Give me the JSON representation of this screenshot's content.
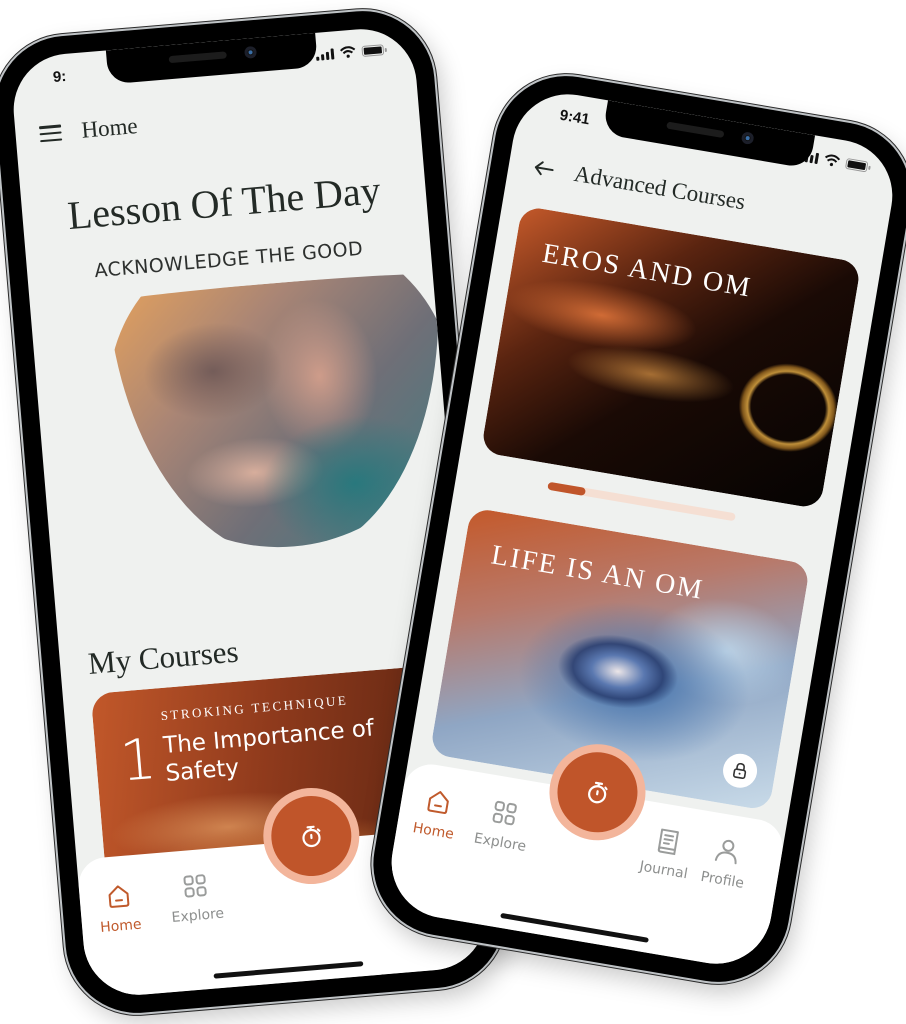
{
  "phones": {
    "left": {
      "status": {
        "time": "9:"
      },
      "header": {
        "title": "Home"
      },
      "lesson": {
        "heading": "Lesson Of The Day",
        "subtitle": "ACKNOWLEDGE THE GOOD",
        "image_alt": "Bare feet resting on cushions"
      },
      "my_courses": {
        "heading": "My Courses",
        "cards": [
          {
            "eyebrow": "STROKING TECHNIQUE",
            "number": "1",
            "title": "The Importance of Safety"
          }
        ]
      },
      "tabs": [
        {
          "label": "Home",
          "icon": "home-icon",
          "active": true
        },
        {
          "label": "Explore",
          "icon": "grid-icon",
          "active": false
        }
      ],
      "fab": {
        "icon": "stopwatch-icon"
      }
    },
    "right": {
      "status": {
        "time": "9:41"
      },
      "header": {
        "title": "Advanced Courses"
      },
      "courses": [
        {
          "title": "EROS AND OM",
          "locked": false
        },
        {
          "title": "LIFE IS AN OM",
          "locked": true
        }
      ],
      "carousel": {
        "progress": 0.2
      },
      "tabs": [
        {
          "label": "Home",
          "icon": "home-icon",
          "active": true
        },
        {
          "label": "Explore",
          "icon": "grid-icon",
          "active": false
        },
        {
          "label": "Journal",
          "icon": "journal-icon",
          "active": false
        },
        {
          "label": "Profile",
          "icon": "profile-icon",
          "active": false
        }
      ],
      "fab": {
        "icon": "stopwatch-icon"
      }
    }
  },
  "colors": {
    "accent": "#c0552a",
    "accent_light": "#f3b59b",
    "background": "#eff1ef",
    "text": "#232a26",
    "inactive": "#8d8f8e"
  }
}
